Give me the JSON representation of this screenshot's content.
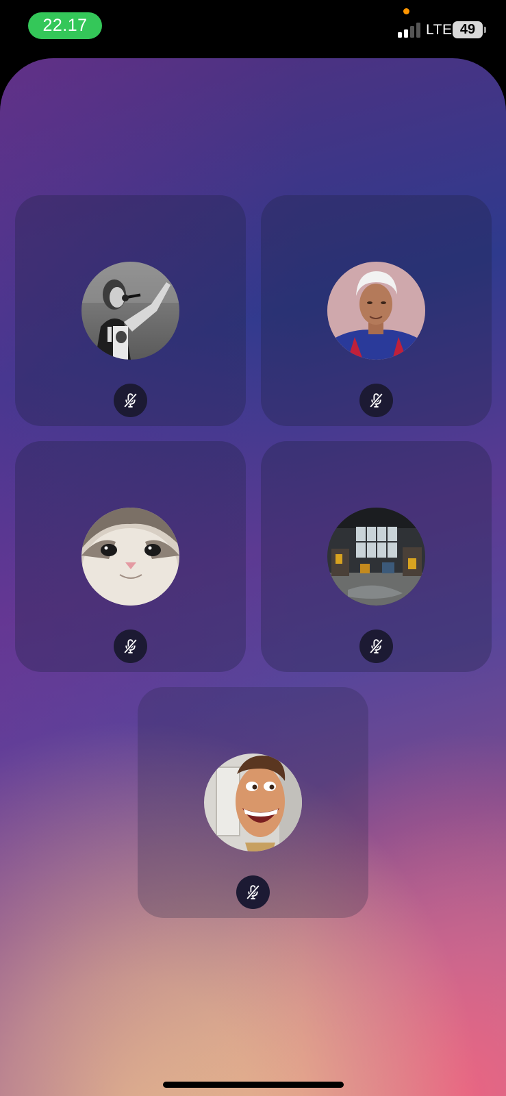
{
  "status_bar": {
    "time": "22.17",
    "network": "LTE",
    "battery": "49",
    "time_pill_color": "#34c759",
    "mic_indicator_color": "#ff9500",
    "signal_bars_active": 2,
    "signal_bars_total": 4
  },
  "participants": [
    {
      "avatar": "singer-photo-avatar",
      "muted": true,
      "mute_icon": "mic-off-icon"
    },
    {
      "avatar": "man-white-hair-photo-avatar",
      "muted": true,
      "mute_icon": "mic-off-icon"
    },
    {
      "avatar": "cat-photo-avatar",
      "muted": true,
      "mute_icon": "mic-off-icon"
    },
    {
      "avatar": "workshop-photo-avatar",
      "muted": true,
      "mute_icon": "mic-off-icon"
    },
    {
      "avatar": "cartoon-cowboy-photo-avatar",
      "muted": true,
      "mute_icon": "mic-off-icon"
    }
  ]
}
